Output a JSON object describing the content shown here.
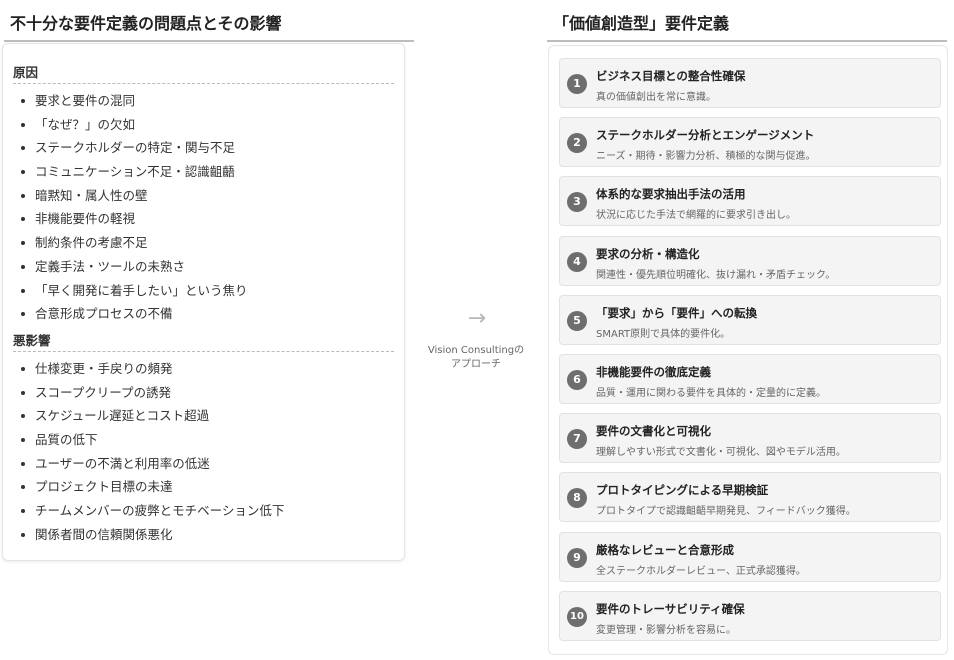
{
  "left": {
    "title": "不十分な要件定義の問題点とその影響",
    "causes": {
      "heading": "原因",
      "items": [
        "要求と要件の混同",
        "「なぜ？」の欠如",
        "ステークホルダーの特定・関与不足",
        "コミュニケーション不足・認識齟齬",
        "暗黙知・属人性の壁",
        "非機能要件の軽視",
        "制約条件の考慮不足",
        "定義手法・ツールの未熟さ",
        "「早く開発に着手したい」という焦り",
        "合意形成プロセスの不備"
      ]
    },
    "effects": {
      "heading": "悪影響",
      "items": [
        "仕様変更・手戻りの頻発",
        "スコープクリープの誘発",
        "スケジュール遅延とコスト超過",
        "品質の低下",
        "ユーザーの不満と利用率の低迷",
        "プロジェクト目標の未達",
        "チームメンバーの疲弊とモチベーション低下",
        "関係者間の信頼関係悪化"
      ]
    }
  },
  "connector": {
    "arrow": "→",
    "caption_line1": "Vision Consultingの",
    "caption_line2": "アプローチ"
  },
  "right": {
    "title": "「価値創造型」要件定義",
    "steps": [
      {
        "num": "1",
        "title": "ビジネス目標との整合性確保",
        "desc": "真の価値創出を常に意識。"
      },
      {
        "num": "2",
        "title": "ステークホルダー分析とエンゲージメント",
        "desc": "ニーズ・期待・影響力分析、積極的な関与促進。"
      },
      {
        "num": "3",
        "title": "体系的な要求抽出手法の活用",
        "desc": "状況に応じた手法で網羅的に要求引き出し。"
      },
      {
        "num": "4",
        "title": "要求の分析・構造化",
        "desc": "関連性・優先順位明確化、抜け漏れ・矛盾チェック。"
      },
      {
        "num": "5",
        "title": "「要求」から「要件」への転換",
        "desc": "SMART原則で具体的要件化。"
      },
      {
        "num": "6",
        "title": "非機能要件の徹底定義",
        "desc": "品質・運用に関わる要件を具体的・定量的に定義。"
      },
      {
        "num": "7",
        "title": "要件の文書化と可視化",
        "desc": "理解しやすい形式で文書化・可視化、図やモデル活用。"
      },
      {
        "num": "8",
        "title": "プロトタイピングによる早期検証",
        "desc": "プロトタイプで認識齟齬早期発見、フィードバック獲得。"
      },
      {
        "num": "9",
        "title": "厳格なレビューと合意形成",
        "desc": "全ステークホルダーレビュー、正式承認獲得。"
      },
      {
        "num": "10",
        "title": "要件のトレーサビリティ確保",
        "desc": "変更管理・影響分析を容易に。"
      }
    ]
  },
  "colors": {
    "badge": "#6e6e6e",
    "step_bg": "#f4f4f4",
    "rule": "#bdbdbd"
  }
}
